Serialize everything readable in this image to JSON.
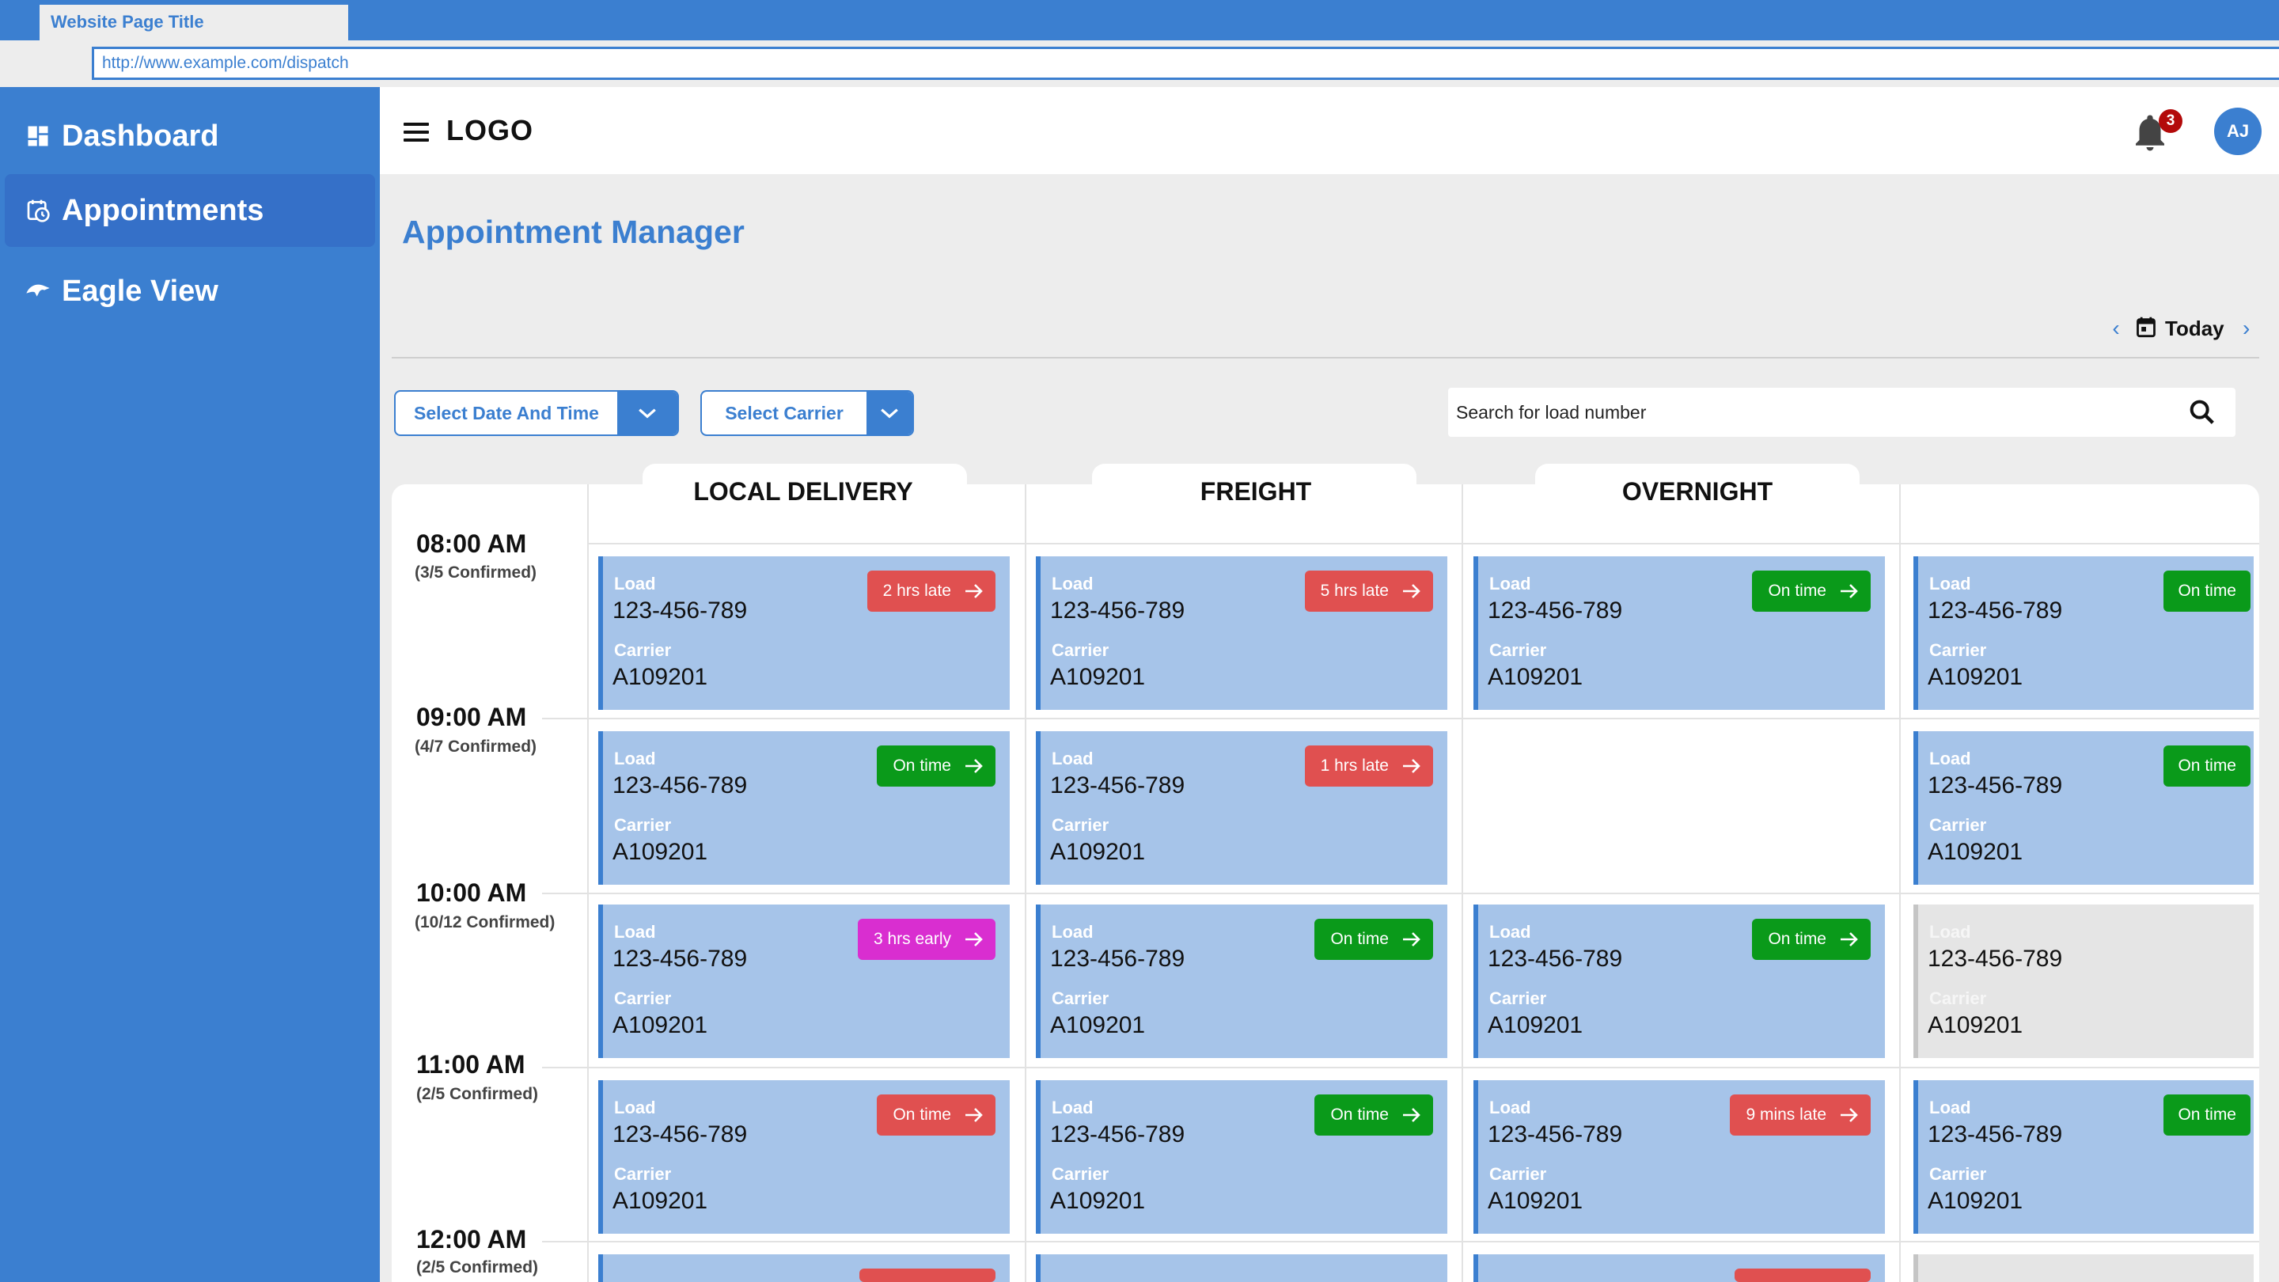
{
  "browser": {
    "tab_title": "Website Page Title",
    "url": "http://www.example.com/dispatch"
  },
  "sidebar": {
    "items": [
      {
        "label": "Dashboard",
        "icon": "dashboard-icon"
      },
      {
        "label": "Appointments",
        "icon": "calendar-clock-icon",
        "active": true
      },
      {
        "label": "Eagle View",
        "icon": "eagle-icon"
      }
    ]
  },
  "header": {
    "logo": "LOGO",
    "notification_count": "3",
    "avatar_initials": "AJ"
  },
  "main": {
    "title": "Appointment Manager",
    "date_nav_label": "Today",
    "filter_date_label": "Select Date And Time",
    "filter_carrier_label": "Select Carrier",
    "search_placeholder": "Search for load number",
    "columns": [
      "LOCAL DELIVERY",
      "FREIGHT",
      "OVERNIGHT",
      ""
    ],
    "time_slots": [
      {
        "time": "08:00 AM",
        "confirmed": "(3/5 Confirmed)"
      },
      {
        "time": "09:00 AM",
        "confirmed": "(4/7 Confirmed)"
      },
      {
        "time": "10:00 AM",
        "confirmed": "(10/12 Confirmed)"
      },
      {
        "time": "11:00 AM",
        "confirmed": "(2/5 Confirmed)"
      },
      {
        "time": "12:00 AM",
        "confirmed": "(2/5 Confirmed)"
      }
    ],
    "card_labels": {
      "load": "Load",
      "carrier": "Carrier"
    },
    "cards": [
      {
        "load": "123-456-789",
        "carrier": "A109201",
        "status": "2 hrs late"
      },
      {
        "load": "123-456-789",
        "carrier": "A109201",
        "status": "5 hrs late"
      },
      {
        "load": "123-456-789",
        "carrier": "A109201",
        "status": "On time"
      },
      {
        "load": "123-456-789",
        "carrier": "A109201",
        "status": "On time"
      },
      {
        "load": "123-456-789",
        "carrier": "A109201",
        "status": "On time"
      },
      {
        "load": "123-456-789",
        "carrier": "A109201",
        "status": "1 hrs late"
      },
      {
        "load": "123-456-789",
        "carrier": "A109201",
        "status": "On time"
      },
      {
        "load": "123-456-789",
        "carrier": "A109201",
        "status": "3 hrs early"
      },
      {
        "load": "123-456-789",
        "carrier": "A109201",
        "status": "On time"
      },
      {
        "load": "123-456-789",
        "carrier": "A109201",
        "status": "On time"
      },
      {
        "load": "123-456-789",
        "carrier": "A109201",
        "status": ""
      },
      {
        "load": "123-456-789",
        "carrier": "A109201",
        "status": "On time"
      },
      {
        "load": "123-456-789",
        "carrier": "A109201",
        "status": "On time"
      },
      {
        "load": "123-456-789",
        "carrier": "A109201",
        "status": "9 mins late"
      },
      {
        "load": "123-456-789",
        "carrier": "A109201",
        "status": "On time"
      }
    ]
  },
  "colors": {
    "primary": "#3b7fd0",
    "card_bg": "#a6c4e9",
    "late": "#e05050",
    "on_time": "#0a9a1a",
    "early": "#d92ed0",
    "badge": "#b30a0a"
  }
}
